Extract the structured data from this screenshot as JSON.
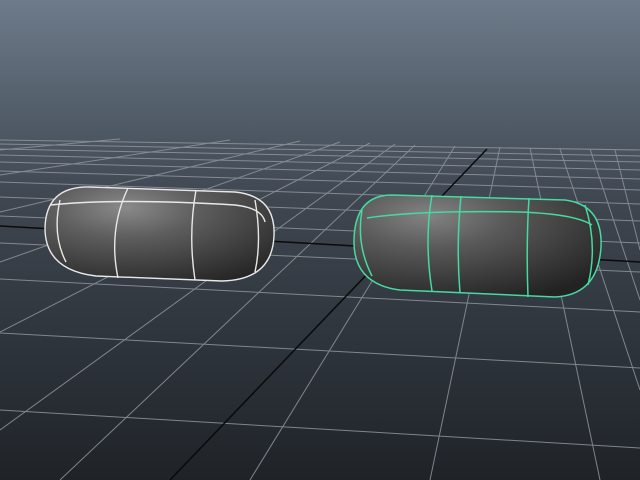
{
  "viewport": {
    "background_top": "#6d7b8a",
    "background_bottom": "#1f2328"
  },
  "grid": {
    "line_color": "#8f959b",
    "axis_color": "#0a0a0a"
  },
  "objects": [
    {
      "kind": "capsule",
      "selected": false,
      "wireframe_color": "#e8e8e8"
    },
    {
      "kind": "capsule",
      "selected": true,
      "wireframe_color": "#46d9a0"
    }
  ]
}
